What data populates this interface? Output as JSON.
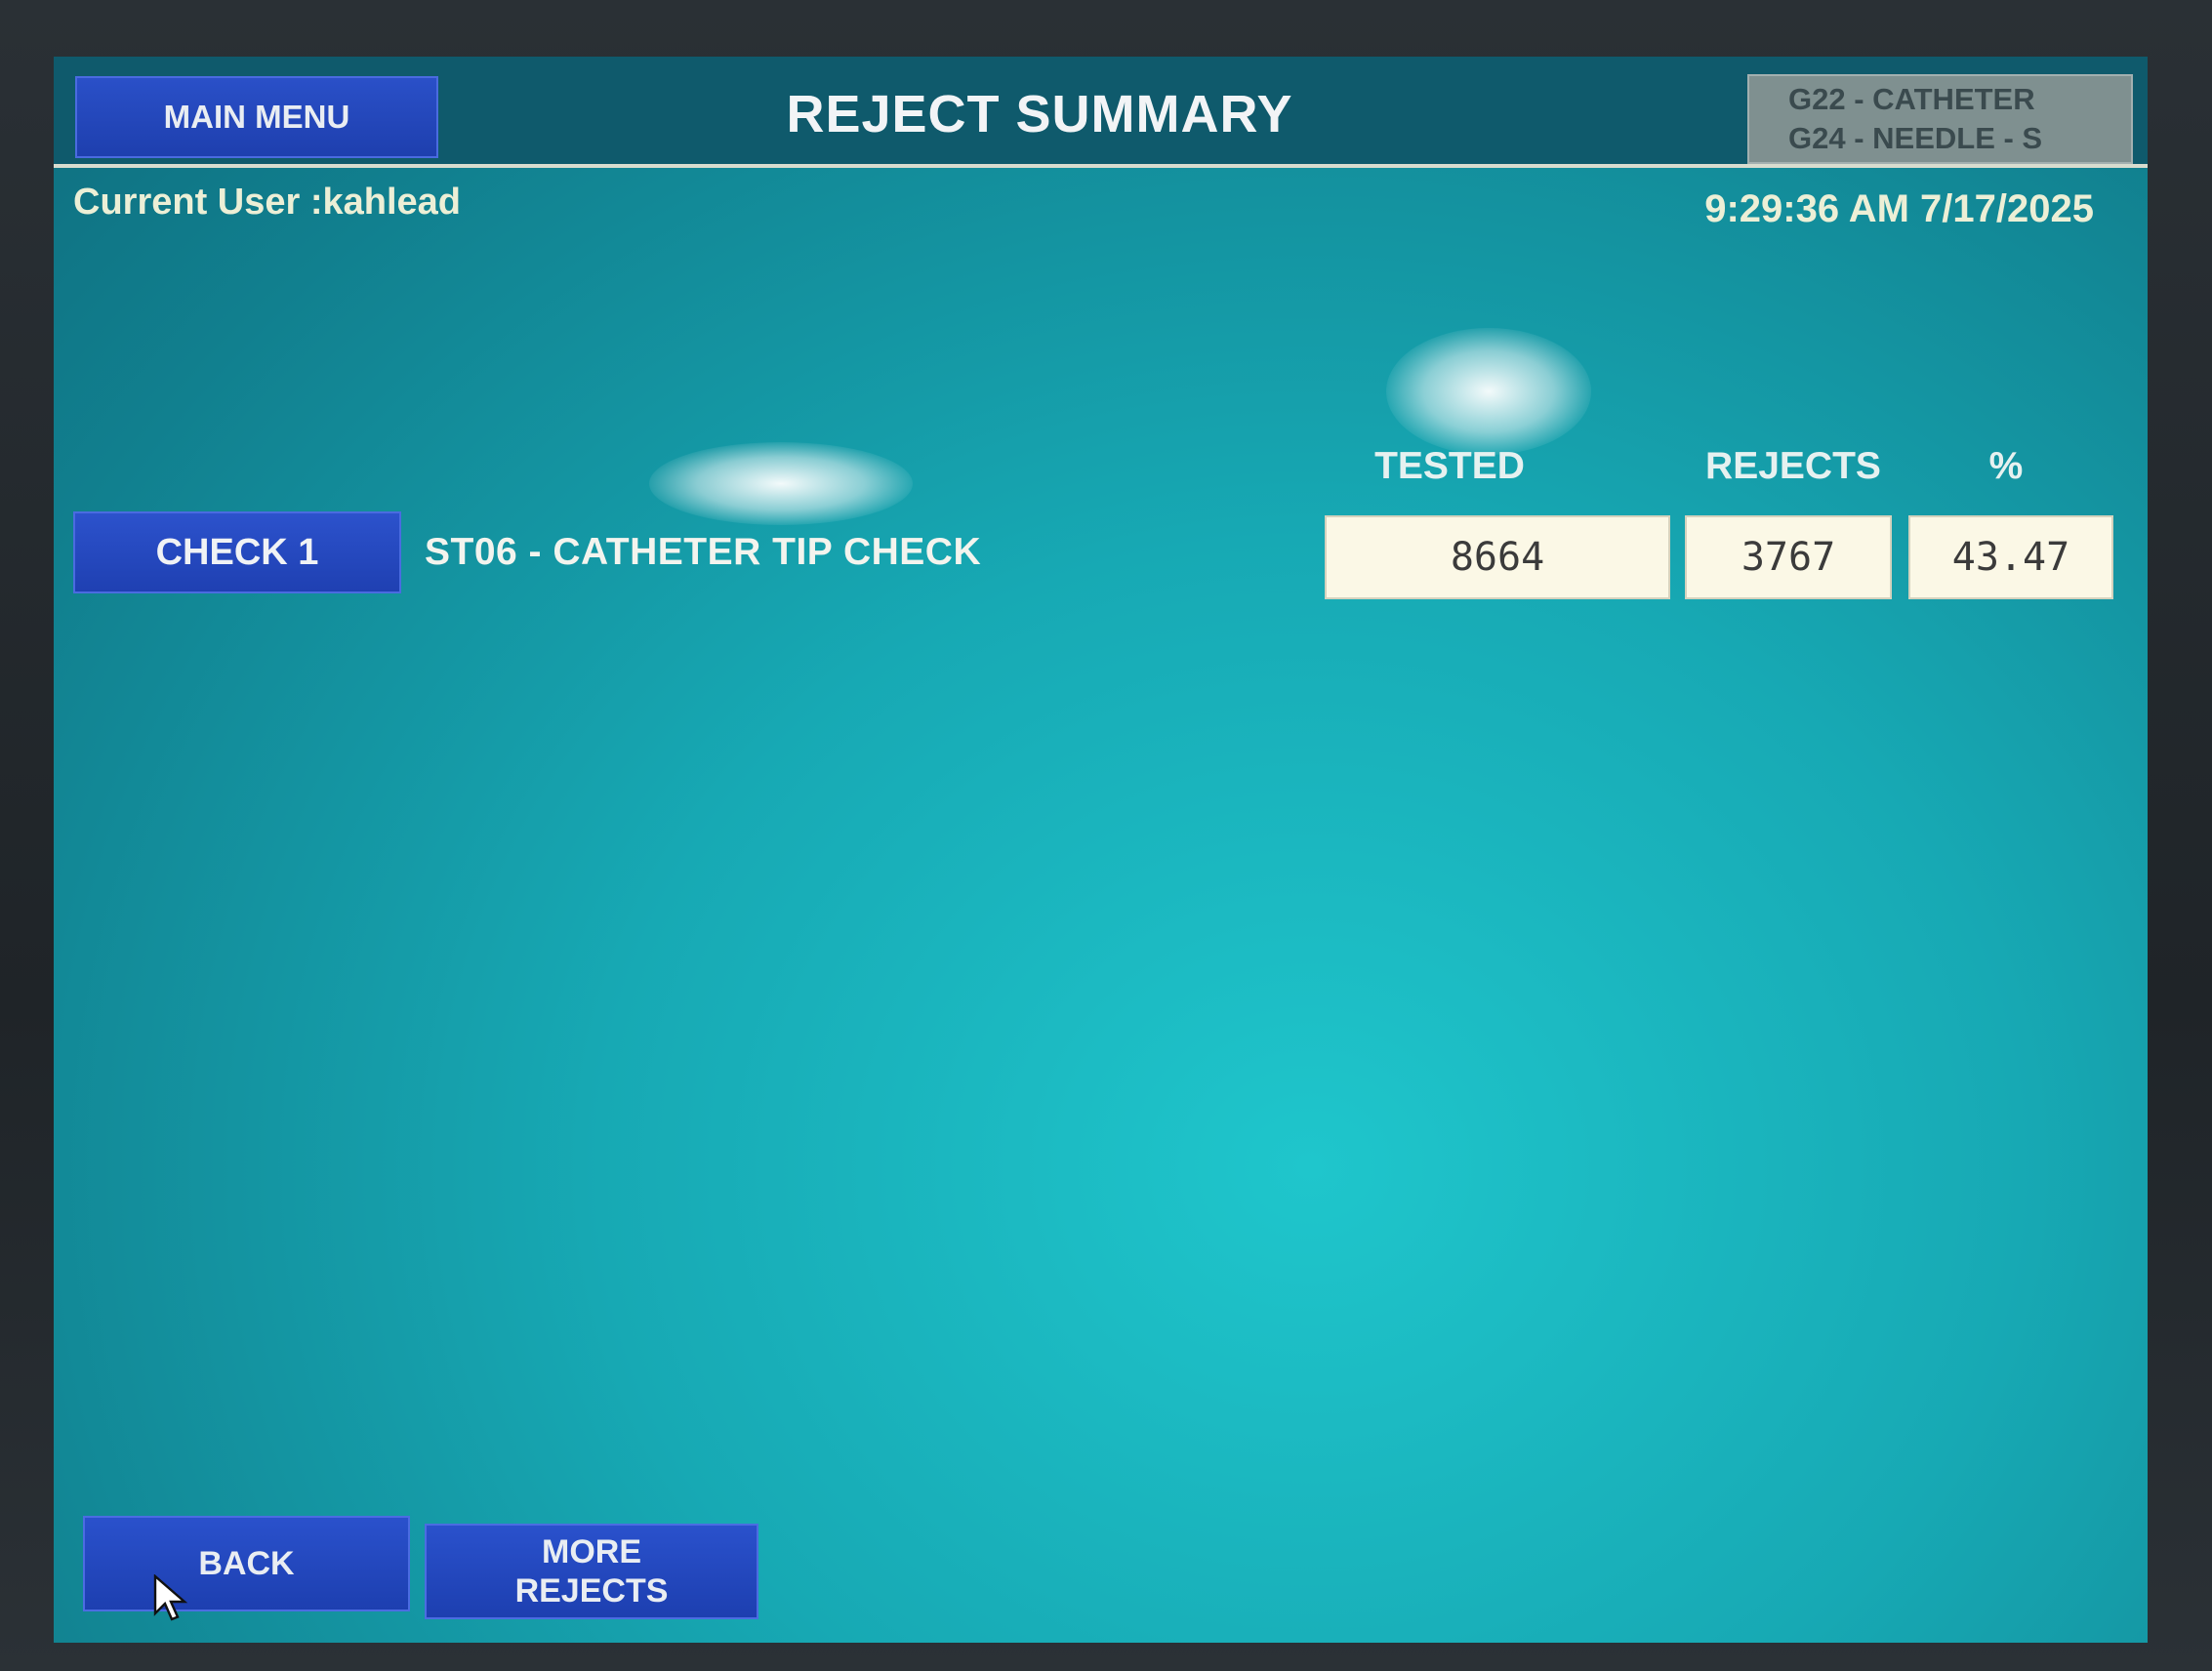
{
  "header": {
    "main_menu_label": "MAIN MENU",
    "title": "REJECT SUMMARY",
    "products": [
      "G22 - CATHETER",
      "G24 - NEEDLE - S"
    ]
  },
  "status": {
    "current_user": "Current User :kahlead",
    "datetime": "9:29:36 AM 7/17/2025"
  },
  "table": {
    "columns": {
      "tested": "TESTED",
      "rejects": "REJECTS",
      "percent": "%"
    },
    "rows": [
      {
        "button_label": "CHECK 1",
        "description": "ST06 - CATHETER TIP CHECK",
        "tested": "8664",
        "rejects": "3767",
        "percent": "43.47"
      }
    ]
  },
  "footer": {
    "back_label": "BACK",
    "more_rejects_line1": "MORE",
    "more_rejects_line2": "REJECTS"
  },
  "colors": {
    "screen_background": "#17a9b4",
    "header_background": "#0f5a6c",
    "button_blue": "#1f40b2",
    "value_box": "#fbf8e6",
    "product_box": "#7f9090"
  }
}
